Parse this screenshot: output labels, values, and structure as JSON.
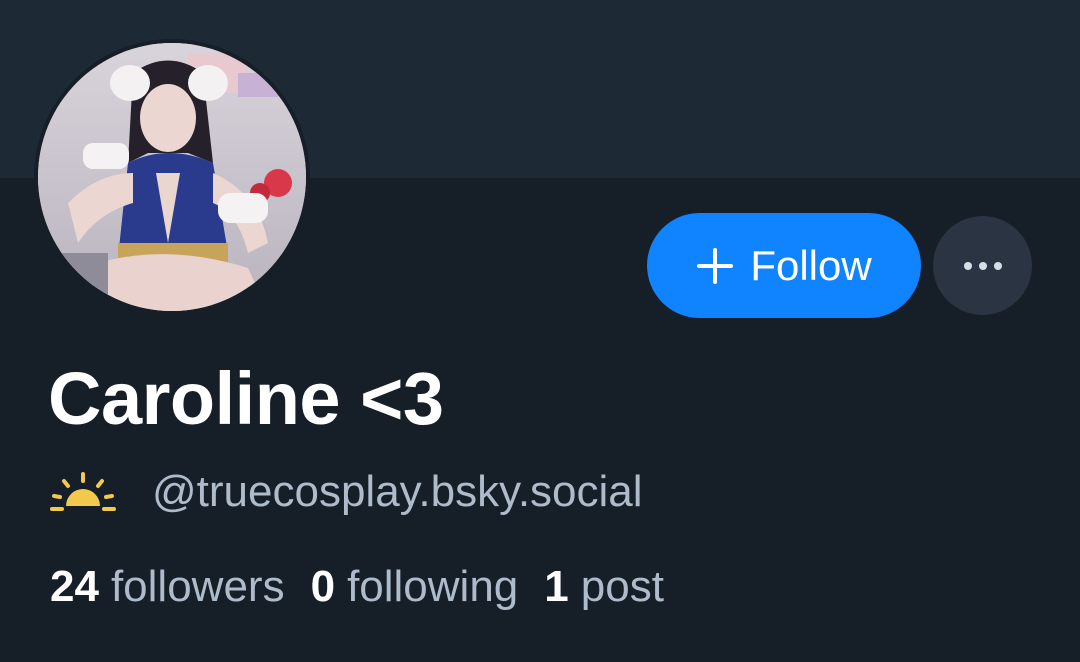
{
  "profile": {
    "display_name": "Caroline <3",
    "handle": "@truecosplay.bsky.social",
    "status_icon": "sun-icon",
    "avatar": "profile-photo"
  },
  "actions": {
    "follow_label": "Follow",
    "follow_icon": "plus-icon",
    "more_icon": "ellipsis-icon"
  },
  "stats": {
    "followers_count": "24",
    "followers_label": "followers",
    "following_count": "0",
    "following_label": "following",
    "posts_count": "1",
    "posts_label": "post"
  },
  "colors": {
    "background": "#161e27",
    "banner": "#1e2936",
    "accent": "#1083fe",
    "muted_text": "#aebbca",
    "sun": "#f2c94c"
  }
}
